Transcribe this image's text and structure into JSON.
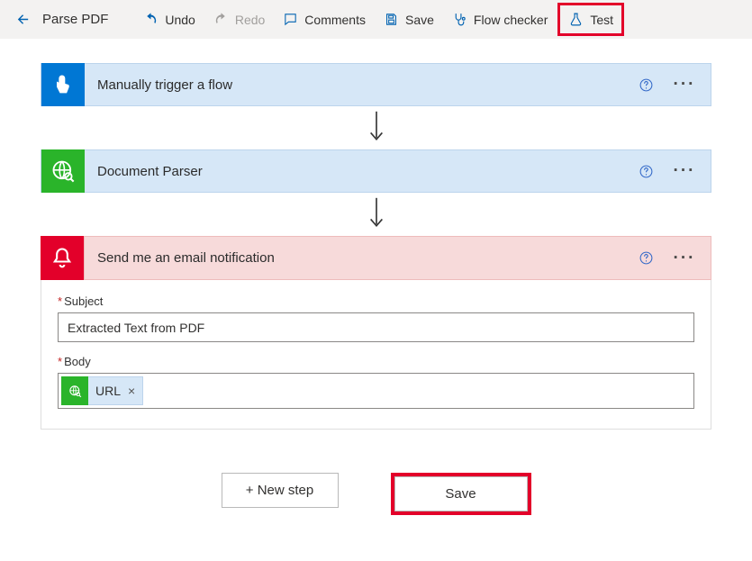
{
  "toolbar": {
    "title": "Parse PDF",
    "undo": "Undo",
    "redo": "Redo",
    "comments": "Comments",
    "save": "Save",
    "flow_checker": "Flow checker",
    "test": "Test"
  },
  "steps": {
    "trigger": {
      "title": "Manually trigger a flow"
    },
    "parser": {
      "title": "Document Parser"
    },
    "email": {
      "title": "Send me an email notification",
      "fields": {
        "subject": {
          "label": "Subject",
          "required": "*",
          "value": "Extracted Text from PDF"
        },
        "body": {
          "label": "Body",
          "required": "*",
          "token": {
            "label": "URL",
            "remove": "×"
          }
        }
      }
    }
  },
  "actions": {
    "new_step": "+ New step",
    "save": "Save"
  },
  "colors": {
    "trigger_bg": "#0077d4",
    "parser_bg": "#2ab42a",
    "email_bg": "#e3002a",
    "highlight": "#e3002a",
    "step_header_blue": "#d6e7f7",
    "step_header_red": "#f7dada"
  }
}
